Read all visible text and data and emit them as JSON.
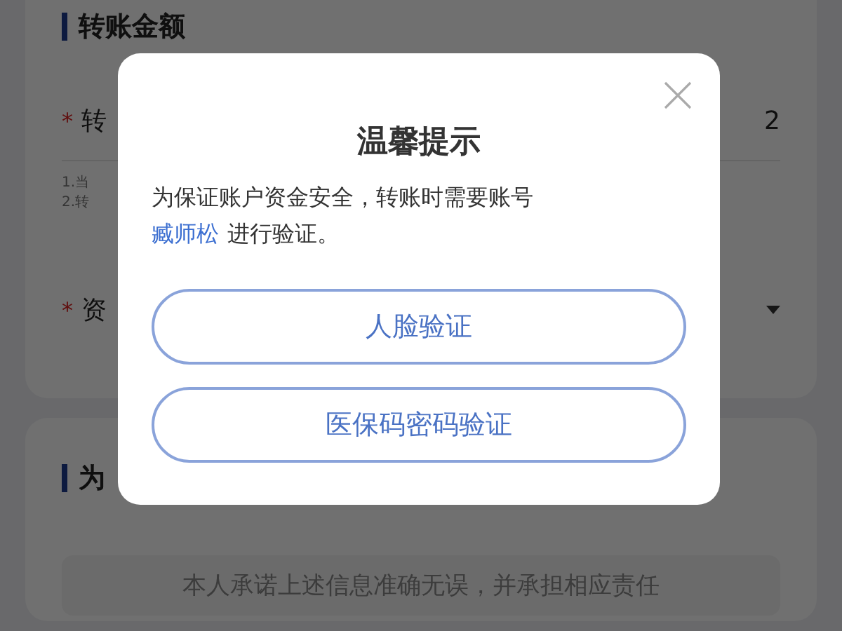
{
  "page": {
    "section_1": {
      "title": "转账金额",
      "required_mark": "*",
      "amount_label": "转",
      "amount_value": "2",
      "notes": [
        "1.当",
        "2.转"
      ],
      "account_label": "资"
    },
    "section_2": {
      "title": "为",
      "pledge": "本人承诺上述信息准确无误，并承担相应责任"
    }
  },
  "dialog": {
    "title": "温馨提示",
    "message": {
      "line_1": "为保证账户资金安全，转账时需要账号",
      "account_name": "臧师松",
      "line_2": "进行验证。"
    },
    "buttons": [
      {
        "label": "人脸验证"
      },
      {
        "label": "医保码密码验证"
      }
    ]
  }
}
